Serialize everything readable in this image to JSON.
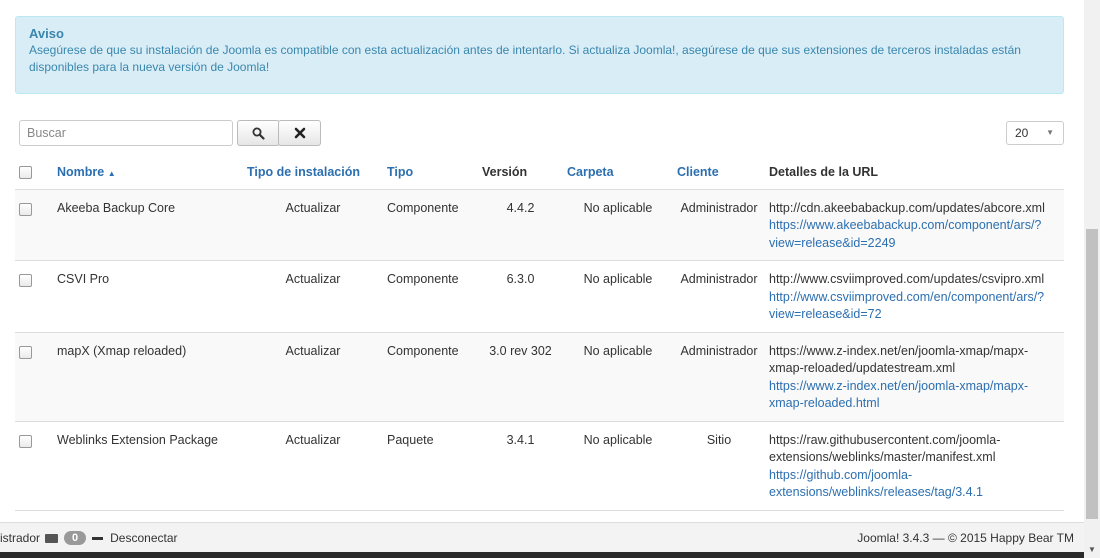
{
  "alert": {
    "title": "Aviso",
    "message": "Asegúrese de que su instalación de Joomla es compatible con esta actualización antes de intentarlo. Si actualiza Joomla!, asegúrese de que sus extensiones de terceros instaladas están disponibles para la nueva versión de Joomla!"
  },
  "search": {
    "placeholder": "Buscar",
    "value": ""
  },
  "icons": {
    "search": "search-icon",
    "clear": "close-icon"
  },
  "list_limit": "20",
  "table": {
    "headers": {
      "name": "Nombre",
      "install_type": "Tipo de instalación",
      "type": "Tipo",
      "version": "Versión",
      "folder": "Carpeta",
      "client": "Cliente",
      "url_details": "Detalles de la URL"
    },
    "rows": [
      {
        "name": "Akeeba Backup Core",
        "install_type": "Actualizar",
        "type": "Componente",
        "version": "4.4.2",
        "folder": "No aplicable",
        "client": "Administrador",
        "url1": "http://cdn.akeebabackup.com/updates/abcore.xml",
        "url2": "https://www.akeebabackup.com/component/ars/?view=release&id=2249"
      },
      {
        "name": "CSVI Pro",
        "install_type": "Actualizar",
        "type": "Componente",
        "version": "6.3.0",
        "folder": "No aplicable",
        "client": "Administrador",
        "url1": "http://www.csviimproved.com/updates/csvipro.xml",
        "url2": "http://www.csviimproved.com/en/component/ars/?view=release&id=72"
      },
      {
        "name": "mapX (Xmap reloaded)",
        "install_type": "Actualizar",
        "type": "Componente",
        "version": "3.0 rev 302",
        "folder": "No aplicable",
        "client": "Administrador",
        "url1": "https://www.z-index.net/en/joomla-xmap/mapx-xmap-reloaded/updatestream.xml",
        "url2": "https://www.z-index.net/en/joomla-xmap/mapx-xmap-reloaded.html"
      },
      {
        "name": "Weblinks Extension Package",
        "install_type": "Actualizar",
        "type": "Paquete",
        "version": "3.4.1",
        "folder": "No aplicable",
        "client": "Sitio",
        "url1": "https://raw.githubusercontent.com/joomla-extensions/weblinks/master/manifest.xml",
        "url2": "https://github.com/joomla-extensions/weblinks/releases/tag/3.4.1"
      }
    ]
  },
  "statusbar": {
    "user_fragment": "istrador",
    "message_count": "0",
    "logout": "Desconectar",
    "footer": "Joomla! 3.4.3 — © 2015 Happy Bear TM"
  }
}
